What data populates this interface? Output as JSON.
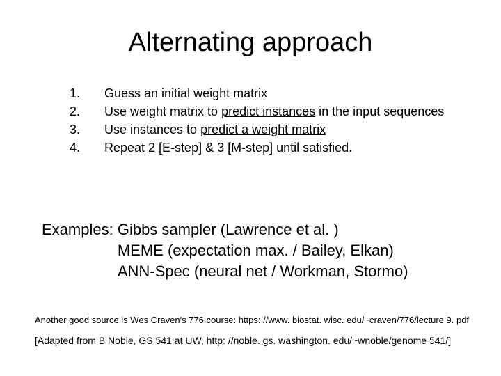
{
  "title": "Alternating approach",
  "steps": [
    {
      "n": "1.",
      "pre": "Guess an initial weight matrix",
      "u": "",
      "post": ""
    },
    {
      "n": "2.",
      "pre": "Use weight matrix to ",
      "u": "predict instances",
      "post": " in the input sequences"
    },
    {
      "n": "3.",
      "pre": "Use instances to ",
      "u": "predict a weight matrix",
      "post": ""
    },
    {
      "n": "4.",
      "pre": "Repeat 2 [E-step] & 3 [M-step] until satisfied.",
      "u": "",
      "post": ""
    }
  ],
  "examples": {
    "label": "Examples: ",
    "lines": [
      "Gibbs sampler (Lawrence et al. )",
      "MEME (expectation max. / Bailey, Elkan)",
      "ANN-Spec (neural net / Workman, Stormo)"
    ]
  },
  "note": "Another good source is Wes Craven's 776 course: https: //www. biostat. wisc. edu/~craven/776/lecture 9. pdf",
  "credit": "[Adapted from B Noble, GS 541 at UW, http: //noble. gs. washington. edu/~wnoble/genome 541/]"
}
